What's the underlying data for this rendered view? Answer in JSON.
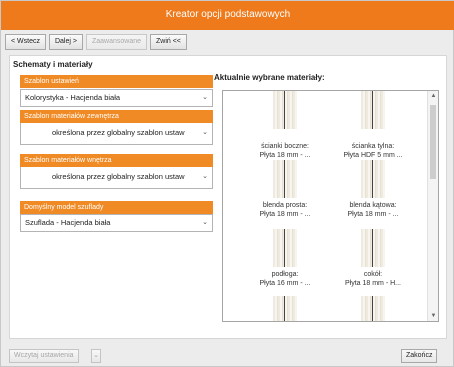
{
  "window": {
    "title": "Kreator opcji podstawowych"
  },
  "toolbar": {
    "back_label": "< Wstecz",
    "next_label": "Dalej >",
    "advanced_label": "Zaawansowane",
    "collapse_label": "Zwiń <<"
  },
  "left": {
    "section_title": "Schematy i materiały",
    "groups": [
      {
        "header": "Szablon ustawień",
        "value": "Kolorystyka - Hacjenda biała"
      },
      {
        "header": "Szablon materiałów zewnętrza",
        "value": "określona przez globalny szablon ustaw"
      },
      {
        "header": "Szablon materiałów wnętrza",
        "value": "określona przez globalny szablon ustaw"
      },
      {
        "header": "Domyślny model szuflady",
        "value": "Szuflada - Hacjenda biała"
      }
    ]
  },
  "right": {
    "title": "Aktualnie wybrane materiały:",
    "materials": [
      {
        "name": "ścianki boczne:",
        "value": "Płyta 18 mm - ..."
      },
      {
        "name": "ścianka tylna:",
        "value": "Płyta HDF 5 mm ..."
      },
      {
        "name": "blenda prosta:",
        "value": "Płyta 18 mm - ..."
      },
      {
        "name": "blenda kątowa:",
        "value": "Płyta 18 mm - ..."
      },
      {
        "name": "podłoga:",
        "value": "Płyta 16 mm - ..."
      },
      {
        "name": "cokół:",
        "value": "Płyta 18 mm - H..."
      }
    ]
  },
  "footer": {
    "load_settings_label": "Wczytaj ustawienia",
    "finish_label": "Zakończ"
  },
  "colors": {
    "accent": "#f08a25",
    "title_bar": "#ee7a1c"
  }
}
